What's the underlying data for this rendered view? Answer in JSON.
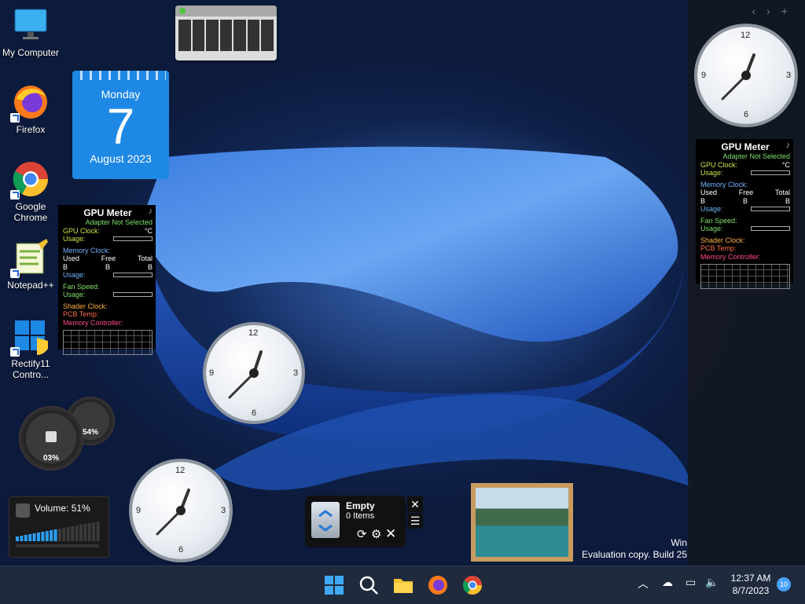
{
  "desktop_icons": [
    {
      "label": "My Computer"
    },
    {
      "label": "Firefox"
    },
    {
      "label": "Google Chrome"
    },
    {
      "label": "Notepad++"
    },
    {
      "label": "Rectify11 Contro..."
    }
  ],
  "calendar": {
    "day": "Monday",
    "date": "7",
    "month": "August 2023"
  },
  "gpu_meter": {
    "title": "GPU Meter",
    "adapter": "Adapter Not Selected",
    "gpu_clock": "GPU Clock:",
    "unit_c": "°C",
    "usage": "Usage:",
    "memory_clock": "Memory Clock:",
    "used": "Used",
    "free": "Free",
    "total": "Total",
    "b": "B",
    "fan_speed": "Fan Speed:",
    "shader_clock": "Shader Clock:",
    "pcb_temp": "PCB Temp:",
    "memory_controller": "Memory Controller:"
  },
  "clock_numbers": {
    "n12": "12",
    "n3": "3",
    "n6": "6",
    "n9": "9"
  },
  "gauges": {
    "cpu": "03%",
    "mem": "54%"
  },
  "volume": {
    "label": "Volume: 51%",
    "level": 0.51
  },
  "recycle_bin": {
    "title": "Empty",
    "items": "0 Items"
  },
  "watermark": {
    "line1": "Win",
    "line2": "Evaluation copy. Build 25"
  },
  "taskbar": {
    "time": "12:37 AM",
    "date": "8/7/2023",
    "notifications": "10"
  },
  "colors": {
    "taskbar": "#1f2a3d",
    "calendar": "#1e88e5",
    "accent": "#4aa3ff"
  }
}
